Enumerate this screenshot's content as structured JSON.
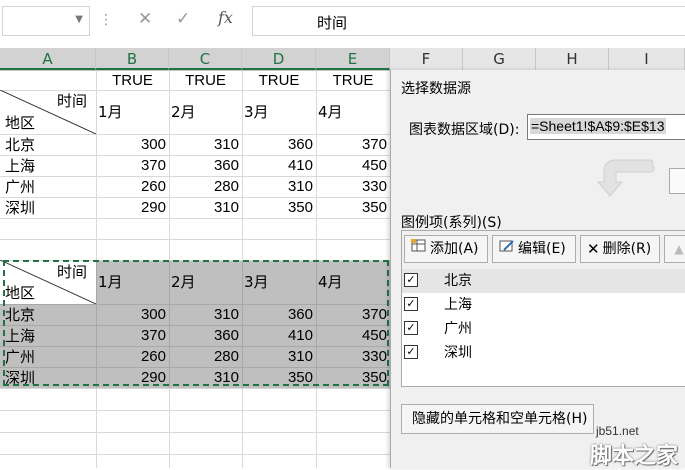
{
  "formula_bar": {
    "name_box_value": "",
    "cancel_icon": "cancel-icon",
    "enter_icon": "check-icon",
    "fx_label": "fx",
    "formula_text": "时间"
  },
  "columns": [
    "A",
    "B",
    "C",
    "D",
    "E",
    "F",
    "G",
    "H",
    "I"
  ],
  "selected_columns": [
    "A",
    "B",
    "C",
    "D",
    "E"
  ],
  "table1": {
    "flags": [
      "TRUE",
      "TRUE",
      "TRUE",
      "TRUE"
    ],
    "header_top": "时间",
    "header_bottom": "地区",
    "months": [
      "1月",
      "2月",
      "3月",
      "4月"
    ],
    "rows": [
      {
        "city": "北京",
        "values": [
          "300",
          "310",
          "360",
          "370"
        ]
      },
      {
        "city": "上海",
        "values": [
          "370",
          "360",
          "410",
          "450"
        ]
      },
      {
        "city": "广州",
        "values": [
          "260",
          "280",
          "310",
          "330"
        ]
      },
      {
        "city": "深圳",
        "values": [
          "290",
          "310",
          "350",
          "350"
        ]
      }
    ]
  },
  "table2": {
    "header_top": "时间",
    "header_bottom": "地区",
    "months": [
      "1月",
      "2月",
      "3月",
      "4月"
    ],
    "rows": [
      {
        "city": "北京",
        "values": [
          "300",
          "310",
          "360",
          "370"
        ]
      },
      {
        "city": "上海",
        "values": [
          "370",
          "360",
          "410",
          "450"
        ]
      },
      {
        "city": "广州",
        "values": [
          "260",
          "280",
          "310",
          "330"
        ]
      },
      {
        "city": "深圳",
        "values": [
          "290",
          "310",
          "350",
          "350"
        ]
      }
    ]
  },
  "dialog": {
    "title": "选择数据源",
    "range_label": "图表数据区域(D):",
    "range_value": "=Sheet1!$A$9:$E$13",
    "legend_label": "图例项(系列)(S)",
    "add_label": "添加(A)",
    "edit_label": "编辑(E)",
    "delete_label": "删除(R)",
    "series": [
      {
        "name": "北京",
        "checked": true
      },
      {
        "name": "上海",
        "checked": true
      },
      {
        "name": "广州",
        "checked": true
      },
      {
        "name": "深圳",
        "checked": true
      }
    ],
    "hidden_cells_label": "隐藏的单元格和空单元格(H)"
  },
  "watermark": {
    "site": "jb51.net",
    "name": "脚本之家"
  },
  "colors": {
    "excel_green": "#217346",
    "selection_grey": "#bfbfbf",
    "dialog_bg": "#f0f0f0"
  }
}
